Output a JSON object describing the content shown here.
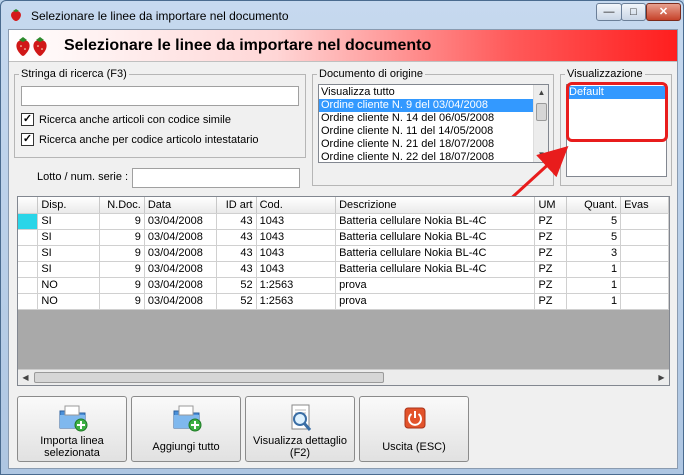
{
  "window": {
    "title": "Selezionare le linee da importare nel documento",
    "minimize_icon": "minimize-icon",
    "maximize_icon": "maximize-icon",
    "close_icon": "close-icon"
  },
  "header": {
    "title": "Selezionare le linee da importare nel documento",
    "icon": "strawberry-icon"
  },
  "search": {
    "legend": "Stringa di ricerca (F3)",
    "value": "",
    "opt_similar_label": "Ricerca anche articoli con codice simile",
    "opt_similar_checked": true,
    "opt_holder_label": "Ricerca anche per codice articolo intestatario",
    "opt_holder_checked": true,
    "lot_label": "Lotto / num. serie :",
    "lot_value": ""
  },
  "origin": {
    "legend": "Documento di origine",
    "items": [
      "Visualizza tutto",
      "Ordine cliente N. 9 del 03/04/2008",
      "Ordine cliente N. 14 del 06/05/2008",
      "Ordine cliente N. 11 del 14/05/2008",
      "Ordine cliente N. 21 del 18/07/2008",
      "Ordine cliente N. 22 del 18/07/2008"
    ],
    "selected_index": 1
  },
  "view": {
    "legend": "Visualizzazione",
    "items": [
      "Default"
    ],
    "selected_index": 0
  },
  "annotation": {
    "color": "#e81c1c"
  },
  "grid": {
    "columns": [
      "",
      "Disp.",
      "N.Doc.",
      "Data",
      "ID art",
      "Cod.",
      "Descrizione",
      "UM",
      "Quant.",
      "Evas"
    ],
    "rows": [
      [
        "",
        "SI",
        "9",
        "03/04/2008",
        "43",
        "1043",
        "Batteria cellulare Nokia BL-4C",
        "PZ",
        "5",
        ""
      ],
      [
        "",
        "SI",
        "9",
        "03/04/2008",
        "43",
        "1043",
        "Batteria cellulare Nokia BL-4C",
        "PZ",
        "5",
        ""
      ],
      [
        "",
        "SI",
        "9",
        "03/04/2008",
        "43",
        "1043",
        "Batteria cellulare Nokia BL-4C",
        "PZ",
        "3",
        ""
      ],
      [
        "",
        "SI",
        "9",
        "03/04/2008",
        "43",
        "1043",
        "Batteria cellulare Nokia BL-4C",
        "PZ",
        "1",
        ""
      ],
      [
        "",
        "NO",
        "9",
        "03/04/2008",
        "52",
        "1:2563",
        "prova",
        "PZ",
        "1",
        ""
      ],
      [
        "",
        "NO",
        "9",
        "03/04/2008",
        "52",
        "1:2563",
        "prova",
        "PZ",
        "1",
        ""
      ]
    ],
    "active_row": 0
  },
  "toolbar": {
    "import_label": "Importa linea selezionata",
    "import_icon": "folder-add-icon",
    "add_all_label": "Aggiungi tutto",
    "add_all_icon": "folder-add-all-icon",
    "detail_label": "Visualizza dettaglio (F2)",
    "detail_icon": "magnifier-document-icon",
    "exit_label": "Uscita (ESC)",
    "exit_icon": "power-icon"
  },
  "colors": {
    "selection": "#3399ff",
    "row_indicator": "#2ad5e8",
    "header_gradient_end": "#ff1e1e"
  }
}
